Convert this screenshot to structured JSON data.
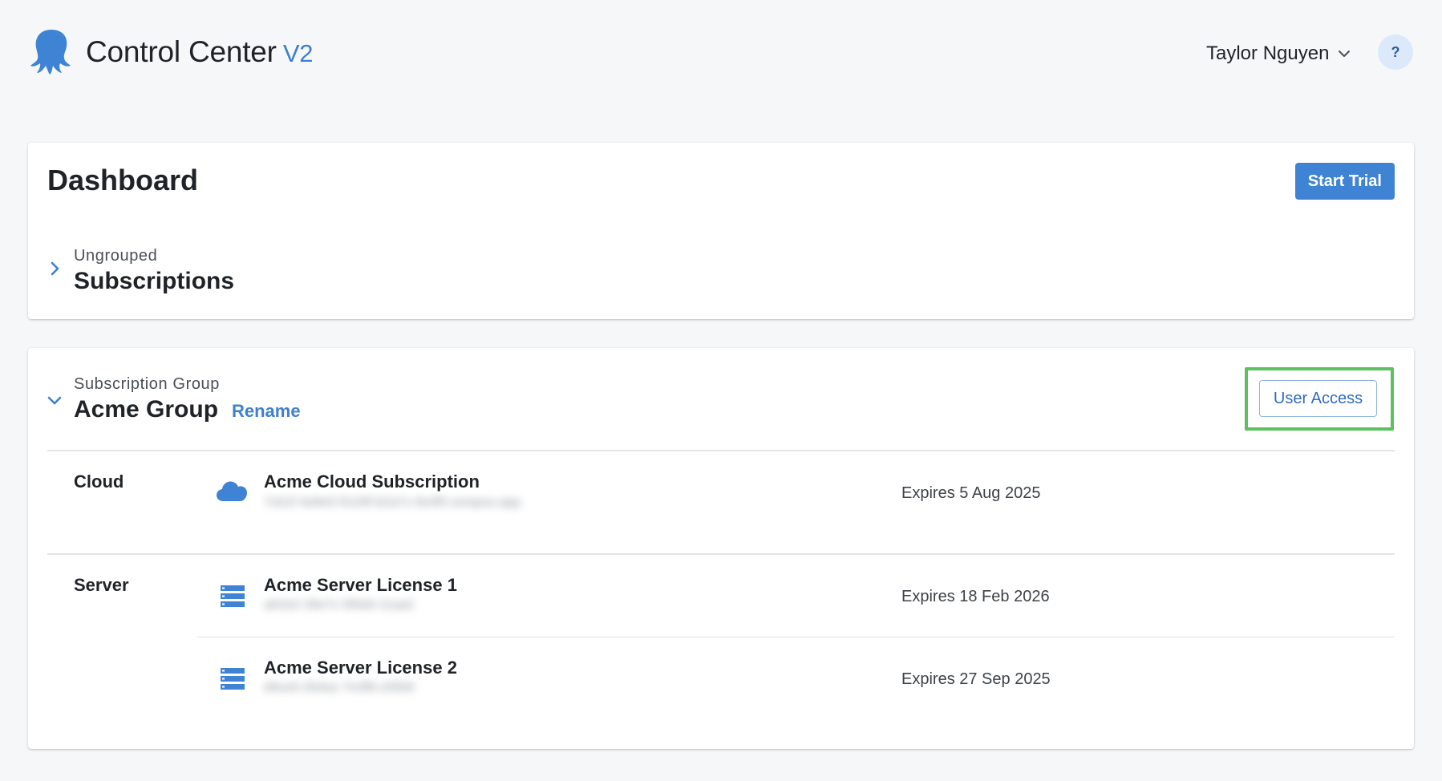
{
  "app": {
    "title": "Control Center",
    "version": "V2"
  },
  "header": {
    "user_name": "Taylor Nguyen",
    "help_label": "?"
  },
  "dashboard": {
    "title": "Dashboard",
    "start_trial_label": "Start Trial",
    "ungrouped": {
      "kicker": "Ungrouped",
      "heading": "Subscriptions"
    }
  },
  "group": {
    "kicker": "Subscription Group",
    "name": "Acme Group",
    "rename_label": "Rename",
    "user_access_label": "User Access",
    "categories": [
      {
        "label": "Cloud",
        "items": [
          {
            "name": "Acme Cloud Subscription",
            "id": "7cb1f-4a9e0-91d3f-b2a7c-0e4f5.octopus.app",
            "expiry": "Expires 5 Aug 2025",
            "icon": "cloud-icon"
          }
        ]
      },
      {
        "label": "Server",
        "items": [
          {
            "name": "Acme Server License 1",
            "id": "a81b2-39e7c-5f0d4-11aa2",
            "expiry": "Expires 18 Feb 2026",
            "icon": "server-icon"
          },
          {
            "name": "Acme Server License 2",
            "id": "d9ce0-2b4a1-7e3f8-c05b9",
            "expiry": "Expires 27 Sep 2025",
            "icon": "server-icon"
          }
        ]
      }
    ]
  },
  "colors": {
    "accent": "#3f84d4",
    "link": "#3f7fd1",
    "highlight": "#5cc15e",
    "background": "#f6f7f9"
  }
}
